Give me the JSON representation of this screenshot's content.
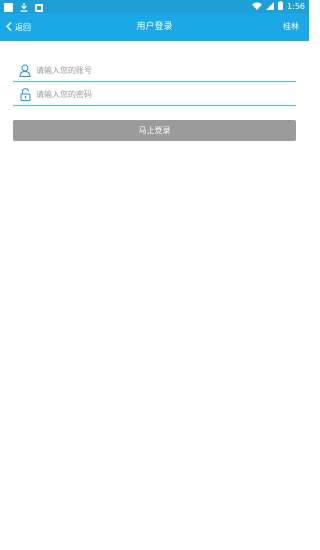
{
  "status_bar": {
    "time": "1:56",
    "icons": [
      "square-notification-icon",
      "download-icon",
      "app-notification-icon",
      "wifi-icon",
      "signal-icon",
      "battery-icon"
    ]
  },
  "header": {
    "back_label": "返回",
    "title": "用户登录",
    "right_action": "桂林"
  },
  "form": {
    "account_placeholder": "请输入您的账号",
    "password_placeholder": "请输入您的密码",
    "submit_label": "马上登录"
  },
  "colors": {
    "status_bar": "#1e9fd6",
    "app_bar": "#1ba8e6",
    "field_underline": "#4fb6e8",
    "icon_blue": "#2a8fd4",
    "button_disabled": "#9b9b9b"
  }
}
